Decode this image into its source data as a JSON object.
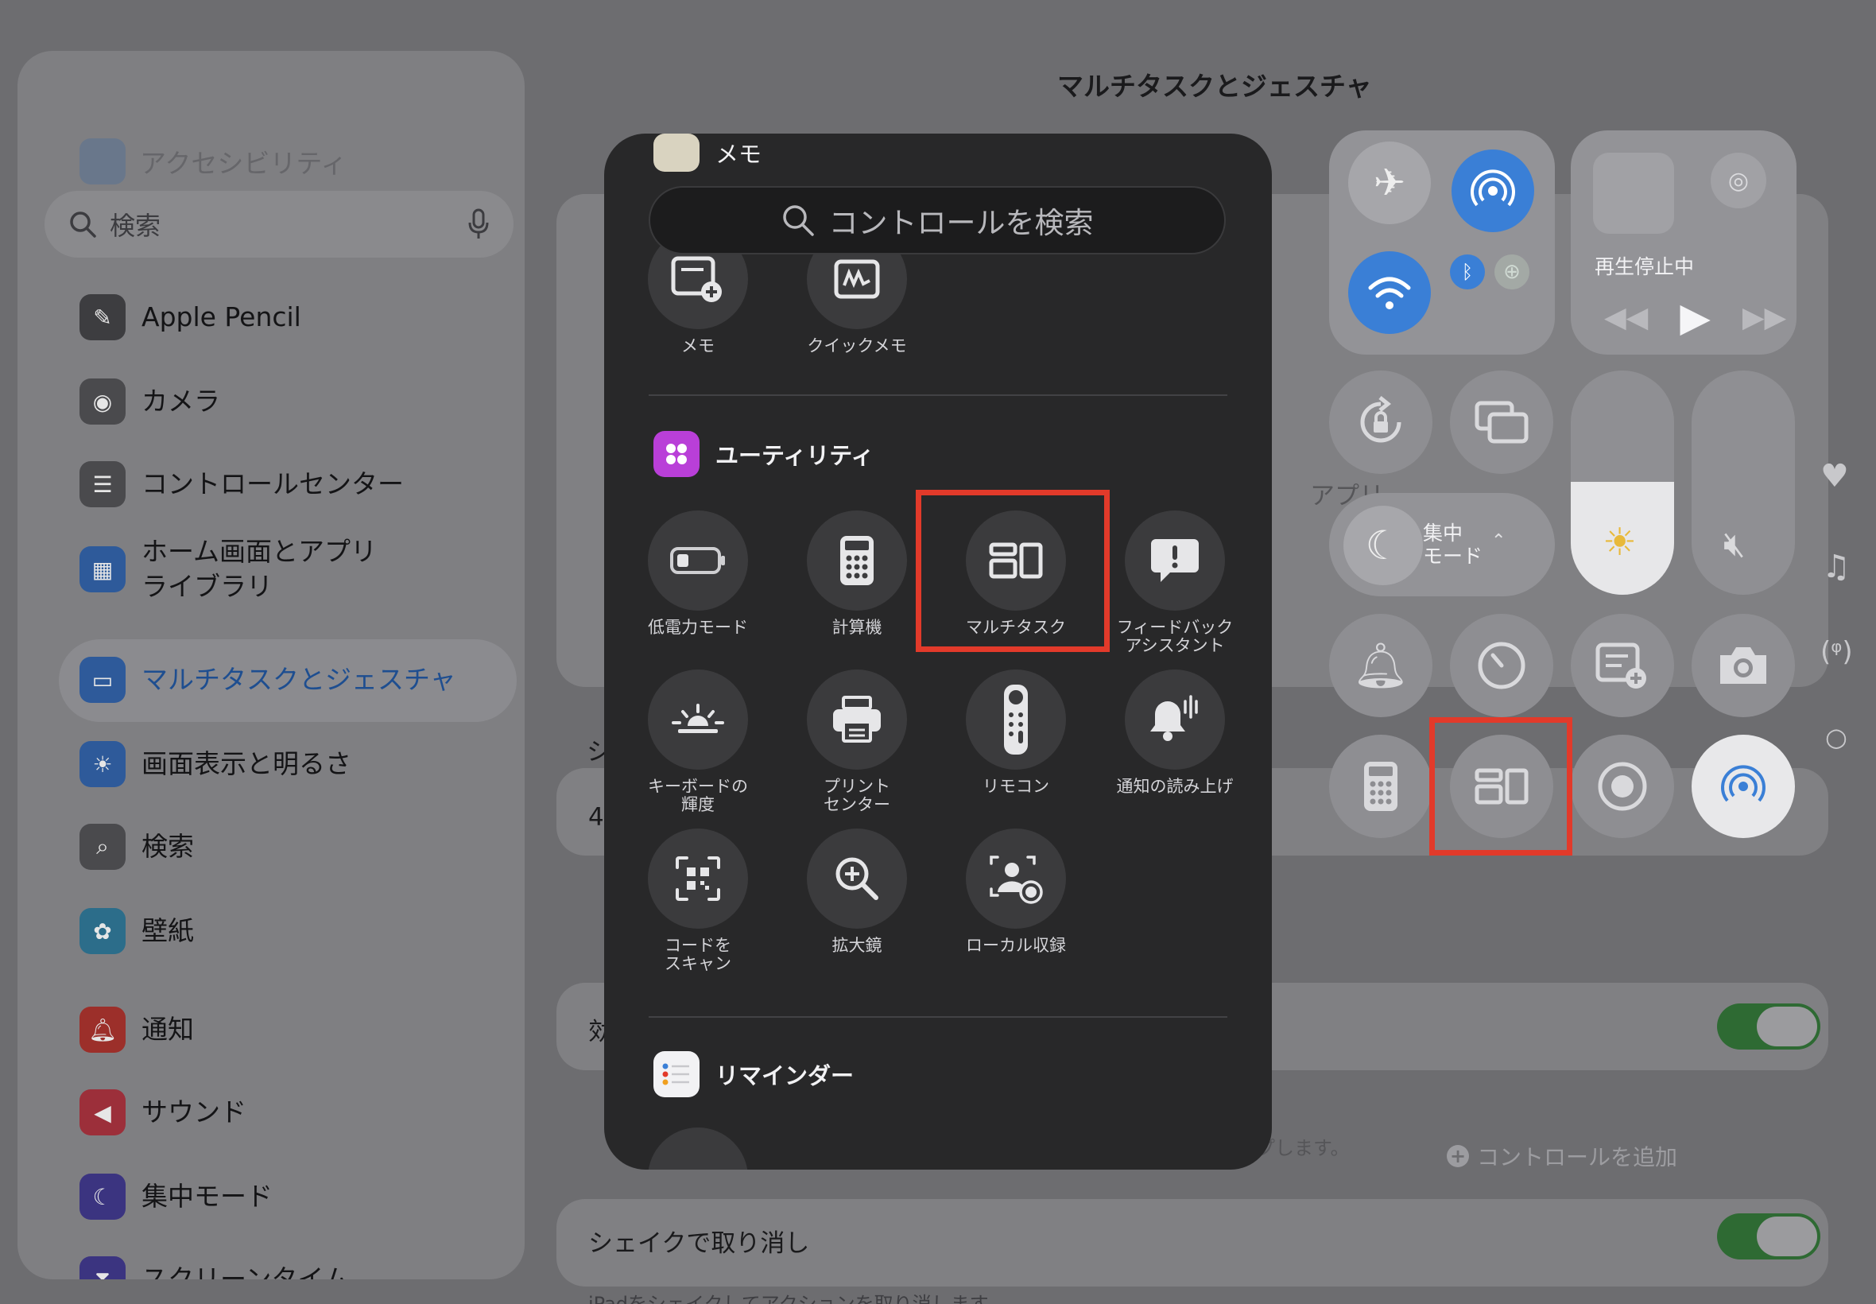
{
  "sidebar": {
    "faded_label": "アクセシビリティ",
    "search_placeholder": "検索",
    "items": [
      {
        "label": "Apple Pencil"
      },
      {
        "label": "カメラ"
      },
      {
        "label": "コントロールセンター"
      },
      {
        "label": "ホーム画面とアプリ\nライブラリ"
      },
      {
        "label": "マルチタスクとジェスチャ"
      },
      {
        "label": "画面表示と明るさ"
      },
      {
        "label": "検索"
      },
      {
        "label": "壁紙"
      },
      {
        "label": "通知"
      },
      {
        "label": "サウンド"
      },
      {
        "label": "集中モード"
      },
      {
        "label": "スクリーンタイム"
      }
    ]
  },
  "detail": {
    "title": "マルチタスクとジェスチャ",
    "partial_a": "シ",
    "partial_b": "4",
    "partial_c": "効",
    "partial_app": "アプリ",
    "partial_tail": "プします。",
    "shake_label": "シェイクで取り消し",
    "shake_sub": "iPadをシェイクしてアクションを取り消します。"
  },
  "control_center": {
    "now_playing": "再生停止中",
    "focus_label": "集中\nモード",
    "add_control": "コントロールを追加"
  },
  "gallery": {
    "search_placeholder": "コントロールを検索",
    "memo_header": "メモ",
    "memo_tiles": [
      {
        "label": "メモ"
      },
      {
        "label": "クイックメモ"
      }
    ],
    "utility_header": "ユーティリティ",
    "utility_tiles": [
      {
        "label": "低電力モード"
      },
      {
        "label": "計算機"
      },
      {
        "label": "マルチタスク"
      },
      {
        "label": "フィードバック\nアシスタント"
      },
      {
        "label": "キーボードの\n輝度"
      },
      {
        "label": "プリント\nセンター"
      },
      {
        "label": "リモコン"
      },
      {
        "label": "通知の読み上げ"
      },
      {
        "label": "コードを\nスキャン"
      },
      {
        "label": "拡大鏡"
      },
      {
        "label": "ローカル収録"
      }
    ],
    "reminders_header": "リマインダー"
  },
  "colors": {
    "highlight": "#e23a2a",
    "accent_blue": "#3a7fd6"
  }
}
